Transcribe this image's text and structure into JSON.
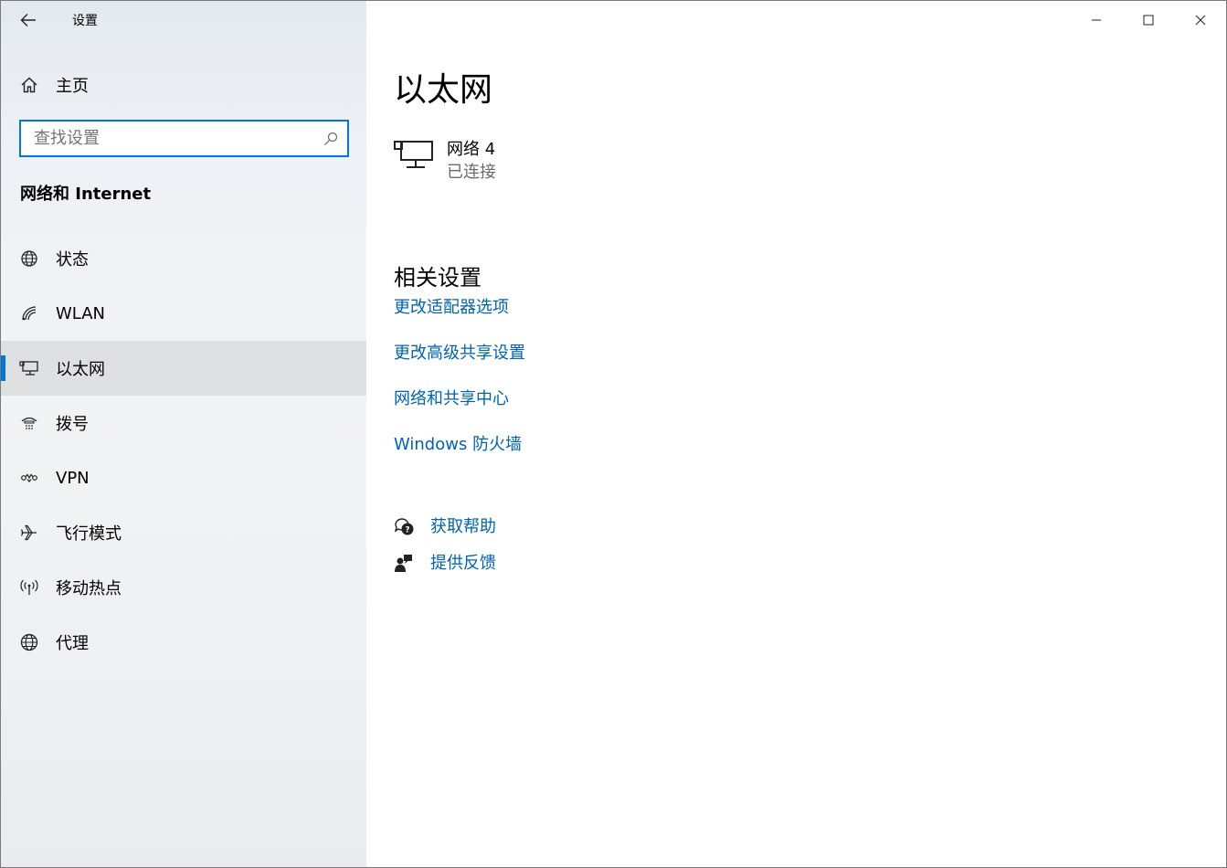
{
  "window": {
    "app_title": "设置",
    "controls": [
      "minimize-icon",
      "maximize-icon",
      "close-icon"
    ]
  },
  "sidebar": {
    "home_label": "主页",
    "search_placeholder": "查找设置",
    "section_title": "网络和 Internet",
    "items": [
      {
        "label": "状态",
        "icon": "status-globe-icon"
      },
      {
        "label": "WLAN",
        "icon": "wifi-icon"
      },
      {
        "label": "以太网",
        "icon": "ethernet-icon",
        "selected": true
      },
      {
        "label": "拨号",
        "icon": "dialup-icon"
      },
      {
        "label": "VPN",
        "icon": "vpn-icon"
      },
      {
        "label": "飞行模式",
        "icon": "airplane-icon"
      },
      {
        "label": "移动热点",
        "icon": "hotspot-icon"
      },
      {
        "label": "代理",
        "icon": "globe-icon"
      }
    ]
  },
  "main": {
    "title": "以太网",
    "network": {
      "name": "网络 4",
      "status": "已连接"
    },
    "related_title": "相关设置",
    "related_links": [
      "更改适配器选项",
      "更改高级共享设置",
      "网络和共享中心",
      "Windows 防火墙"
    ],
    "help": {
      "get_help": "获取帮助",
      "feedback": "提供反馈"
    }
  },
  "colors": {
    "accent": "#0078d7",
    "link": "#0063b1"
  }
}
